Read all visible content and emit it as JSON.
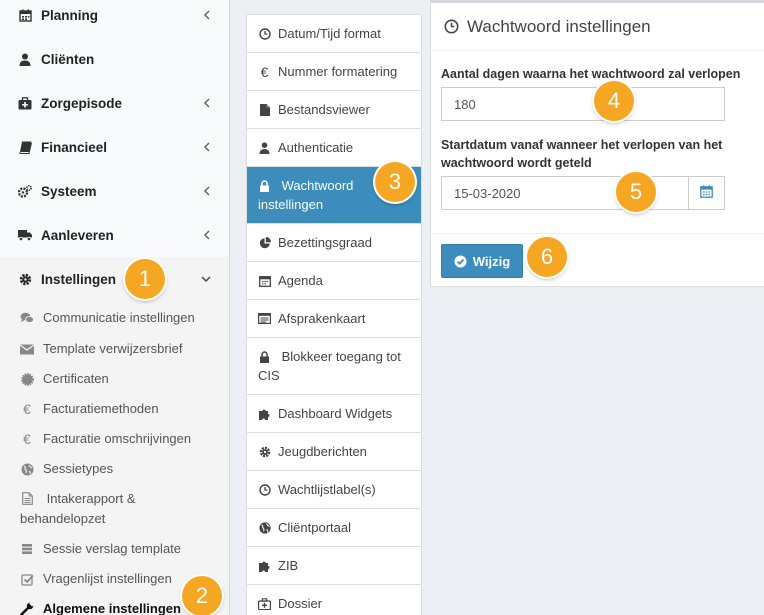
{
  "sidebar": {
    "menu": [
      {
        "label": "Planning",
        "icon": "calendar-icon",
        "has_chevron": true
      },
      {
        "label": "Cliënten",
        "icon": "user-icon",
        "has_chevron": false
      },
      {
        "label": "Zorgepisode",
        "icon": "medkit-icon",
        "has_chevron": true
      },
      {
        "label": "Financieel",
        "icon": "book-icon",
        "has_chevron": true
      },
      {
        "label": "Systeem",
        "icon": "cogs-icon",
        "has_chevron": true
      },
      {
        "label": "Aanleveren",
        "icon": "truck-icon",
        "has_chevron": true
      },
      {
        "label": "Instellingen",
        "icon": "gear-icon",
        "has_chevron": true,
        "expanded": true
      }
    ],
    "sub_items": [
      {
        "label": "Communicatie instellingen",
        "icon": "comments-icon"
      },
      {
        "label": "Template verwijzersbrief",
        "icon": "envelope-icon"
      },
      {
        "label": "Certificaten",
        "icon": "certificate-icon"
      },
      {
        "label": "Facturatiemethoden",
        "icon": "euro-icon"
      },
      {
        "label": "Facturatie omschrijvingen",
        "icon": "euro-icon"
      },
      {
        "label": "Sessietypes",
        "icon": "globe-icon"
      },
      {
        "label": "Intakerapport & behandelopzet",
        "icon": "file-icon"
      },
      {
        "label": "Sessie verslag template",
        "icon": "server-icon"
      },
      {
        "label": "Vragenlijst instellingen",
        "icon": "check-square-icon"
      },
      {
        "label": "Algemene instellingen",
        "icon": "wrench-icon",
        "active": true
      }
    ]
  },
  "settings_list": [
    {
      "label": "Datum/Tijd format",
      "icon": "clock-icon"
    },
    {
      "label": "Nummer formatering",
      "icon": "euro-icon"
    },
    {
      "label": "Bestandsviewer",
      "icon": "file-icon"
    },
    {
      "label": "Authenticatie",
      "icon": "user-icon"
    },
    {
      "label": "Wachtwoord instellingen",
      "icon": "lock-icon",
      "active": true
    },
    {
      "label": "Bezettingsgraad",
      "icon": "pie-chart-icon"
    },
    {
      "label": "Agenda",
      "icon": "calendar-icon"
    },
    {
      "label": "Afsprakenkaart",
      "icon": "id-card-icon"
    },
    {
      "label": "Blokkeer toegang tot CIS",
      "icon": "lock-icon"
    },
    {
      "label": "Dashboard Widgets",
      "icon": "puzzle-icon"
    },
    {
      "label": "Jeugdberichten",
      "icon": "gear-icon"
    },
    {
      "label": "Wachtlijstlabel(s)",
      "icon": "clock-icon"
    },
    {
      "label": "Cliëntportaal",
      "icon": "globe-icon"
    },
    {
      "label": "ZIB",
      "icon": "puzzle-icon"
    },
    {
      "label": "Dossier",
      "icon": "medkit-icon"
    }
  ],
  "panel": {
    "title": "Wachtwoord instellingen",
    "days_label": "Aantal dagen waarna het wachtwoord zal verlopen",
    "days_value": "180",
    "start_label": "Startdatum vanaf wanneer het verlopen van het wachtwoord wordt geteld",
    "start_value": "15-03-2020",
    "submit_label": "Wijzig"
  },
  "badges": [
    "1",
    "2",
    "3",
    "4",
    "5",
    "6"
  ],
  "colors": {
    "primary": "#3c8dbc",
    "badge": "#f5a623",
    "sidebar_bg": "#f9fafc",
    "body_bg": "#ecf0f5"
  }
}
